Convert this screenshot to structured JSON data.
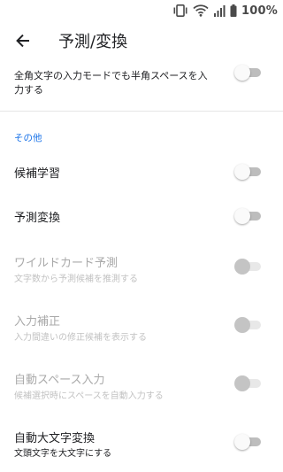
{
  "status_bar": {
    "battery_percent": "100%",
    "icons": [
      "vibrate-icon",
      "wifi-icon",
      "signal-icon",
      "battery-icon"
    ]
  },
  "app_bar": {
    "title": "予測/変換",
    "back_icon": "arrow-back-icon"
  },
  "partial_item": {
    "summary_line1": "全角文字の入力モードでも半角スペースを入",
    "summary_line2": "力する",
    "toggle_checked": false,
    "enabled": true
  },
  "section_other": {
    "header": "その他",
    "items": [
      {
        "title": "候補学習",
        "summary": "",
        "checked": false,
        "enabled": true
      },
      {
        "title": "予測変換",
        "summary": "",
        "checked": false,
        "enabled": true
      },
      {
        "title": "ワイルドカード予測",
        "summary": "文字数から予測候補を推測する",
        "checked": false,
        "enabled": false
      },
      {
        "title": "入力補正",
        "summary": "入力間違いの修正候補を表示する",
        "checked": false,
        "enabled": false
      },
      {
        "title": "自動スペース入力",
        "summary": "候補選択時にスペースを自動入力する",
        "checked": false,
        "enabled": false
      },
      {
        "title": "自動大文字変換",
        "summary": "文頭文字を大文字にする",
        "checked": false,
        "enabled": true
      }
    ]
  },
  "colors": {
    "accent": "#1a73e8",
    "text_primary": "#202124",
    "text_disabled": "#a9a9a9",
    "switch_track_off": "#bdbdbd"
  }
}
